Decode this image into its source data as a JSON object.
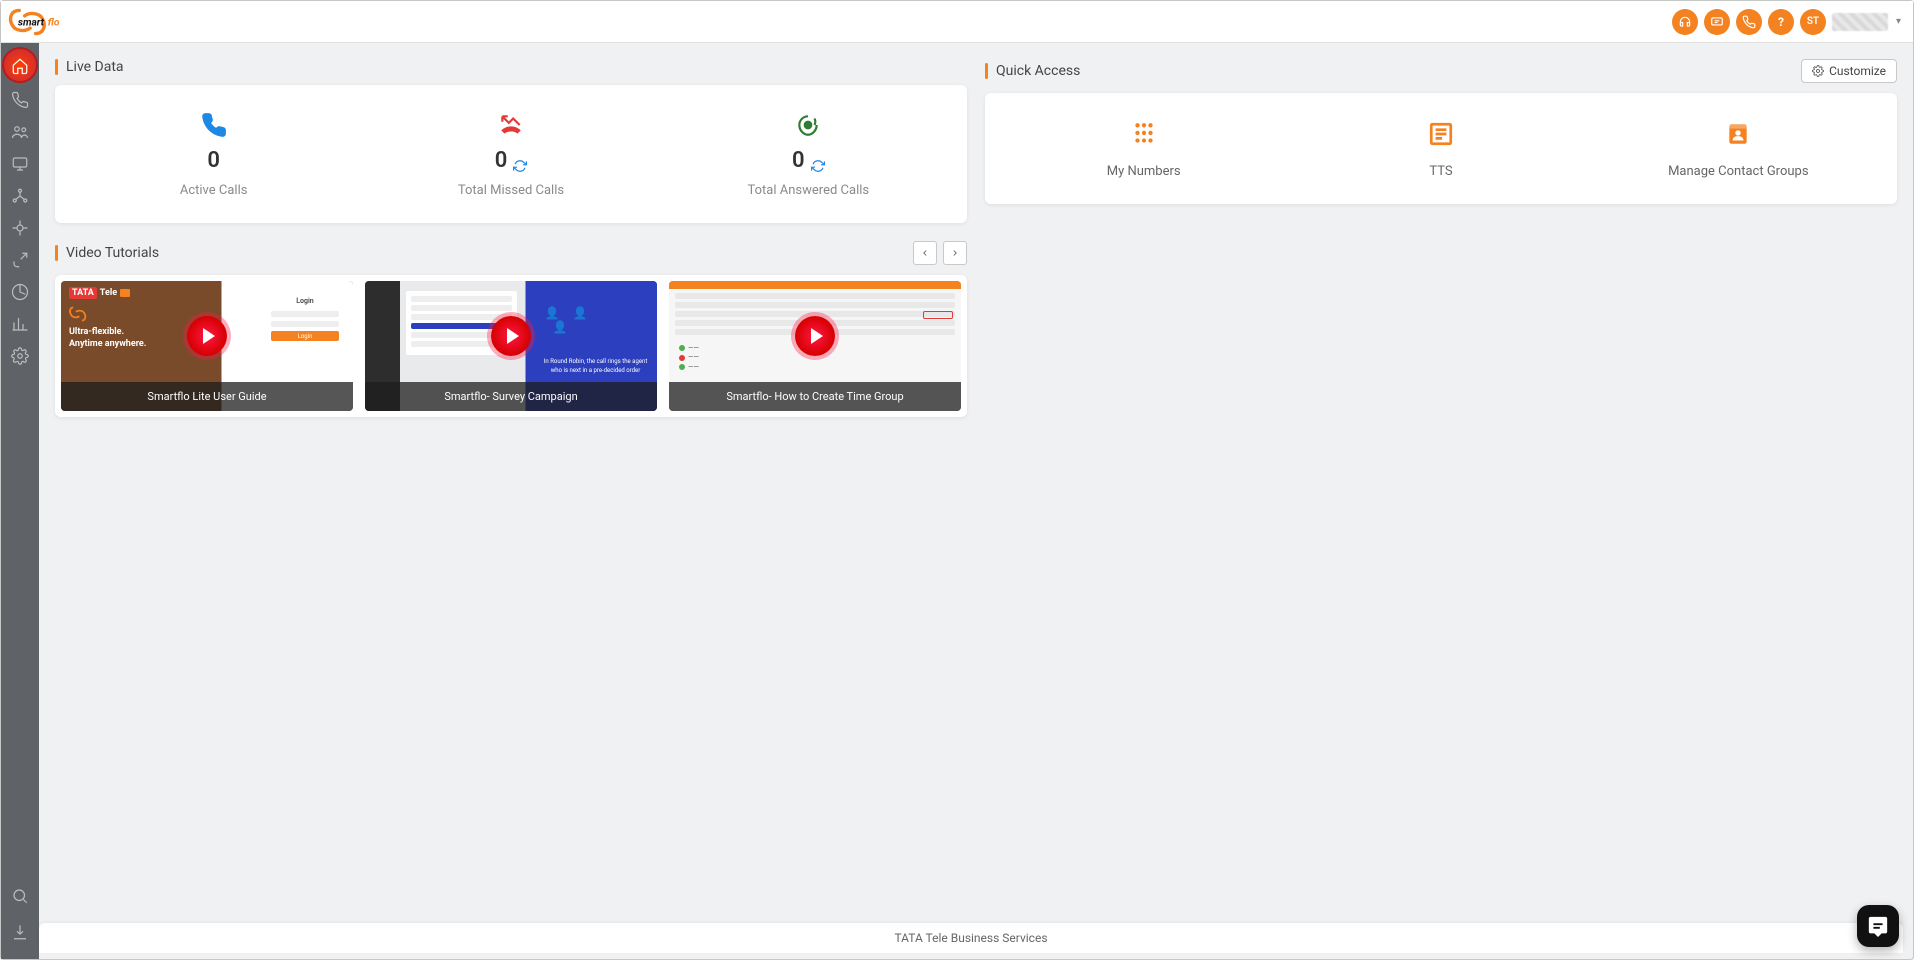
{
  "brand": {
    "name": "smartflo"
  },
  "topbar": {
    "avatar_initials": "ST"
  },
  "sidebar": {
    "items": [
      {
        "name": "home",
        "active": true
      },
      {
        "name": "calls"
      },
      {
        "name": "contacts"
      },
      {
        "name": "monitor"
      },
      {
        "name": "network"
      },
      {
        "name": "integrations"
      },
      {
        "name": "inbound"
      },
      {
        "name": "reports"
      },
      {
        "name": "analytics"
      },
      {
        "name": "settings"
      }
    ],
    "bottom": [
      {
        "name": "search"
      },
      {
        "name": "download"
      }
    ]
  },
  "live_data": {
    "title": "Live Data",
    "items": [
      {
        "value": "0",
        "label": "Active Calls",
        "icon": "phone",
        "color": "#1e88e5",
        "refresh": false
      },
      {
        "value": "0",
        "label": "Total Missed Calls",
        "icon": "missed-call",
        "color": "#e53935",
        "refresh": true
      },
      {
        "value": "0",
        "label": "Total Answered Calls",
        "icon": "answered",
        "color": "#2e7d32",
        "refresh": true
      }
    ]
  },
  "quick_access": {
    "title": "Quick Access",
    "customize_label": "Customize",
    "items": [
      {
        "label": "My Numbers",
        "icon": "dial-pad"
      },
      {
        "label": "TTS",
        "icon": "list-box"
      },
      {
        "label": "Manage Contact Groups",
        "icon": "contact-book"
      }
    ]
  },
  "video_tutorials": {
    "title": "Video Tutorials",
    "items": [
      {
        "title": "Smartflo Lite User Guide",
        "tagline1": "Ultra-flexible.",
        "tagline2": "Anytime anywhere.",
        "login_label": "Login",
        "login_btn": "Login"
      },
      {
        "title": "Smartflo- Survey Campaign",
        "note": "In Round Robin, the call rings the agent who is next in a pre-decided order"
      },
      {
        "title": "Smartflo- How to Create Time Group"
      }
    ]
  },
  "footer": {
    "text": "TATA Tele Business Services"
  }
}
